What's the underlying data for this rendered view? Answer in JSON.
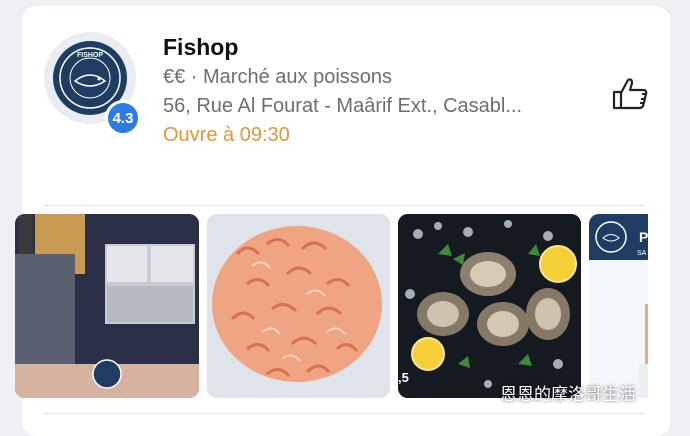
{
  "place": {
    "name": "Fishop",
    "rating": "4.3",
    "price_category": "€€ · Marché aux poissons",
    "address": "56, Rue Al Fourat - Maârif Ext., Casabl...",
    "hours": "Ouvre à 09:30"
  },
  "logo": {
    "text": "FISHOP"
  },
  "actions": {
    "like_icon": "thumbs-up-icon"
  },
  "photos": [
    {
      "name": "storefront"
    },
    {
      "name": "shrimp"
    },
    {
      "name": "oysters",
      "badge": ",5"
    },
    {
      "name": "partial",
      "label": "P",
      "sublabel": "SA"
    }
  ],
  "watermark": "恩恩的摩洛哥生活",
  "colors": {
    "rating_badge": "#2e7be6",
    "hours_text": "#e3953a",
    "logo_bg": "#1f3d63"
  }
}
